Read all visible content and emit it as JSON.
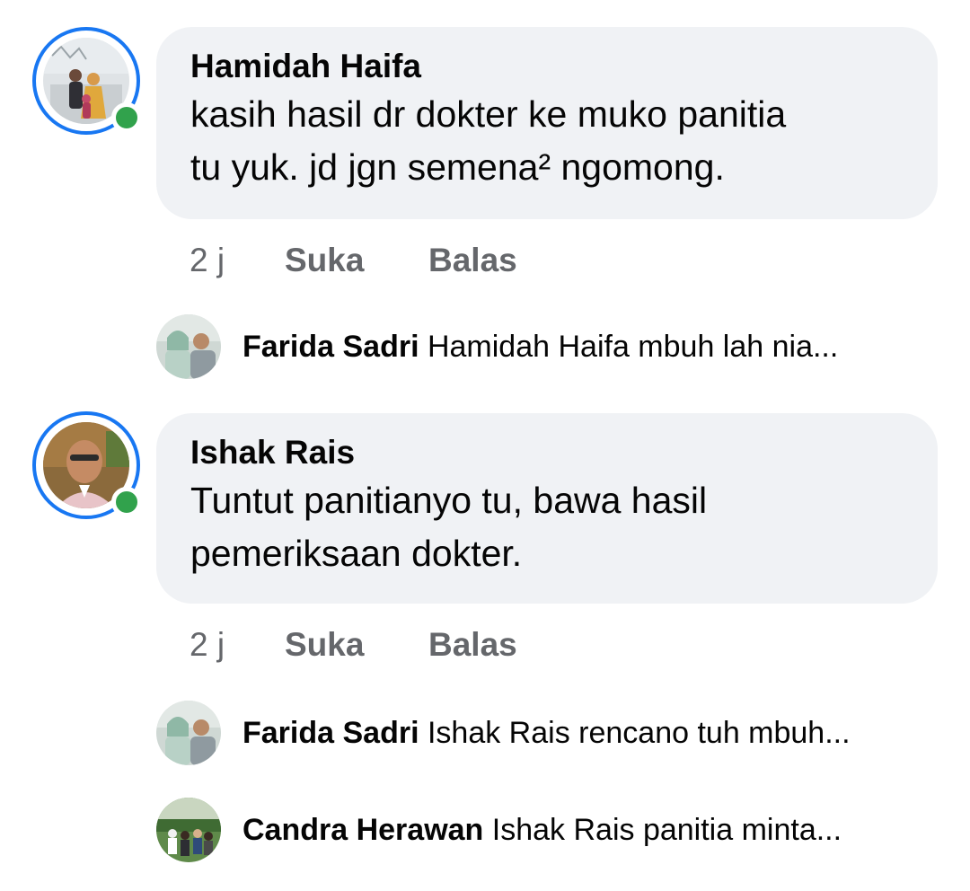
{
  "comments": [
    {
      "author": "Hamidah Haifa",
      "text_line1": "kasih hasil dr dokter ke muko panitia",
      "text_line2": "tu yuk. jd jgn semena² ngomong.",
      "time": "2 j",
      "like_label": "Suka",
      "reply_label": "Balas",
      "online": true,
      "replies": [
        {
          "author": "Farida Sadri",
          "preview": "Hamidah Haifa mbuh lah nia..."
        }
      ]
    },
    {
      "author": "Ishak Rais",
      "text_line1": "Tuntut panitianyo tu, bawa hasil",
      "text_line2": "pemeriksaan dokter.",
      "time": "2 j",
      "like_label": "Suka",
      "reply_label": "Balas",
      "online": true,
      "replies": [
        {
          "author": "Farida Sadri",
          "preview": "Ishak Rais rencano tuh mbuh..."
        },
        {
          "author": "Candra Herawan",
          "preview": "Ishak Rais panitia minta..."
        }
      ]
    }
  ],
  "colors": {
    "bubble": "#f0f2f5",
    "story_ring": "#1877f2",
    "online": "#31a24c",
    "secondary_text": "#65676b"
  }
}
